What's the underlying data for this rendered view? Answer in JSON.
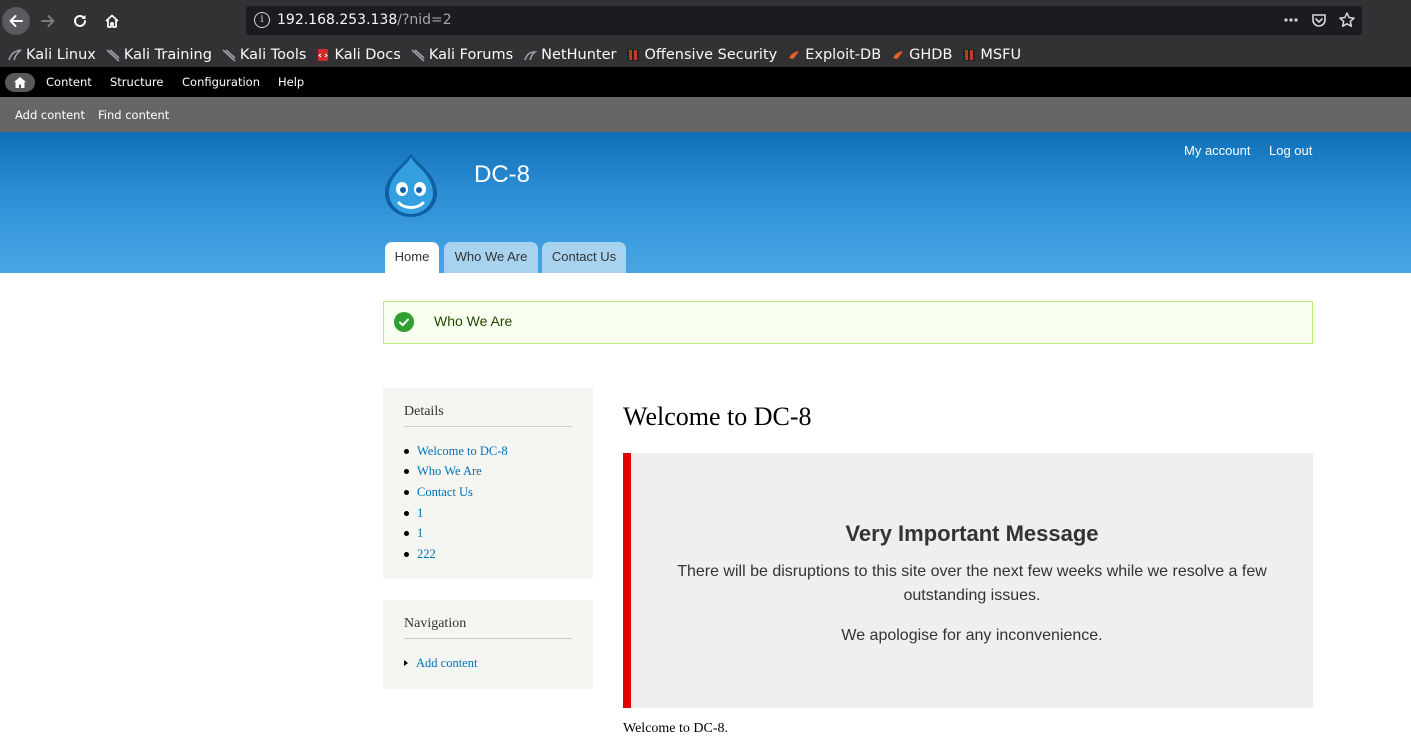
{
  "browser": {
    "url_host": "192.168.253.138",
    "url_path": "/?nid=2",
    "bookmarks": [
      {
        "label": "Kali Linux",
        "icon": "kali-icon",
        "color": "#9aa0a6"
      },
      {
        "label": "Kali Training",
        "icon": "kali-icon",
        "color": "#9aa0a6"
      },
      {
        "label": "Kali Tools",
        "icon": "kali-icon",
        "color": "#9aa0a6"
      },
      {
        "label": "Kali Docs",
        "icon": "kali-docs-icon",
        "color": "#d12b2b"
      },
      {
        "label": "Kali Forums",
        "icon": "kali-icon",
        "color": "#9aa0a6"
      },
      {
        "label": "NetHunter",
        "icon": "nethunter-icon",
        "color": "#9aa0a6"
      },
      {
        "label": "Offensive Security",
        "icon": "offsec-icon",
        "color": "#c0392b"
      },
      {
        "label": "Exploit-DB",
        "icon": "exploitdb-icon",
        "color": "#e8602c"
      },
      {
        "label": "GHDB",
        "icon": "ghdb-icon",
        "color": "#e8602c"
      },
      {
        "label": "MSFU",
        "icon": "msfu-icon",
        "color": "#c0392b"
      }
    ]
  },
  "toolbar": {
    "items": [
      "Content",
      "Structure",
      "Configuration",
      "Help"
    ],
    "shortcuts": [
      "Add content",
      "Find content"
    ]
  },
  "header": {
    "site_name": "DC-8",
    "user_links": [
      "My account",
      "Log out"
    ],
    "tabs": [
      "Home",
      "Who We Are",
      "Contact Us"
    ]
  },
  "status": {
    "message": "Who We Are"
  },
  "sidebar": {
    "details_title": "Details",
    "details_links": [
      "Welcome to DC-8",
      "Who We Are",
      "Contact Us",
      "1",
      "1",
      "222"
    ],
    "navigation_title": "Navigation",
    "navigation_links": [
      "Add content"
    ]
  },
  "main": {
    "title": "Welcome to DC-8",
    "notice_heading": "Very Important Message",
    "notice_line1": "There will be disruptions to this site over the next few weeks while we resolve a few outstanding issues.",
    "notice_line2": "We apologise for any inconvenience.",
    "body_text": "Welcome to DC-8."
  },
  "colors": {
    "header_top": "#0f6fb7",
    "header_bottom": "#46a6e4",
    "link": "#0071b3",
    "notice_border": "#e00000",
    "status_bg": "#f8fff0"
  }
}
